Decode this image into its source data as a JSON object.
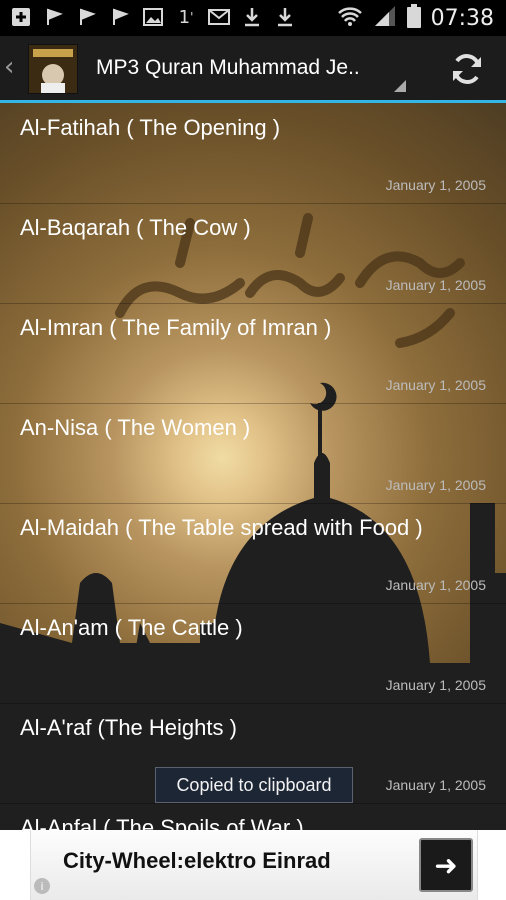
{
  "status_bar": {
    "time": "07:38",
    "icons": [
      "add-icon",
      "flag-icon",
      "flag-icon",
      "flag-icon",
      "image-icon",
      "usb-icon",
      "mail-icon",
      "download-icon",
      "download-icon",
      "wifi-icon",
      "signal-icon",
      "battery-icon"
    ],
    "number_label": "1"
  },
  "action_bar": {
    "title": "MP3 Quran Muhammad Je..",
    "up_icon": "chevron-left-icon",
    "refresh_icon": "refresh-icon"
  },
  "list": {
    "items": [
      {
        "title": "Al-Fatihah ( The Opening )",
        "date": "January 1, 2005"
      },
      {
        "title": "Al-Baqarah ( The Cow )",
        "date": "January 1, 2005"
      },
      {
        "title": "Al-Imran ( The Family of Imran )",
        "date": "January 1, 2005"
      },
      {
        "title": "An-Nisa ( The Women )",
        "date": "January 1, 2005"
      },
      {
        "title": "Al-Maidah ( The Table spread with Food )",
        "date": "January 1, 2005"
      },
      {
        "title": "Al-An'am ( The Cattle )",
        "date": "January 1, 2005"
      },
      {
        "title": "Al-A'raf (The Heights )",
        "date": "January 1, 2005"
      },
      {
        "title": "Al-Anfal ( The Spoils of War )",
        "date": ""
      }
    ]
  },
  "toast": {
    "text": "Copied to clipboard"
  },
  "ad": {
    "text": "City-Wheel:elektro Einrad",
    "info": "i",
    "arrow": "➜"
  },
  "colors": {
    "accent": "#33b5e5",
    "action_bar": "#1c1c1c"
  }
}
